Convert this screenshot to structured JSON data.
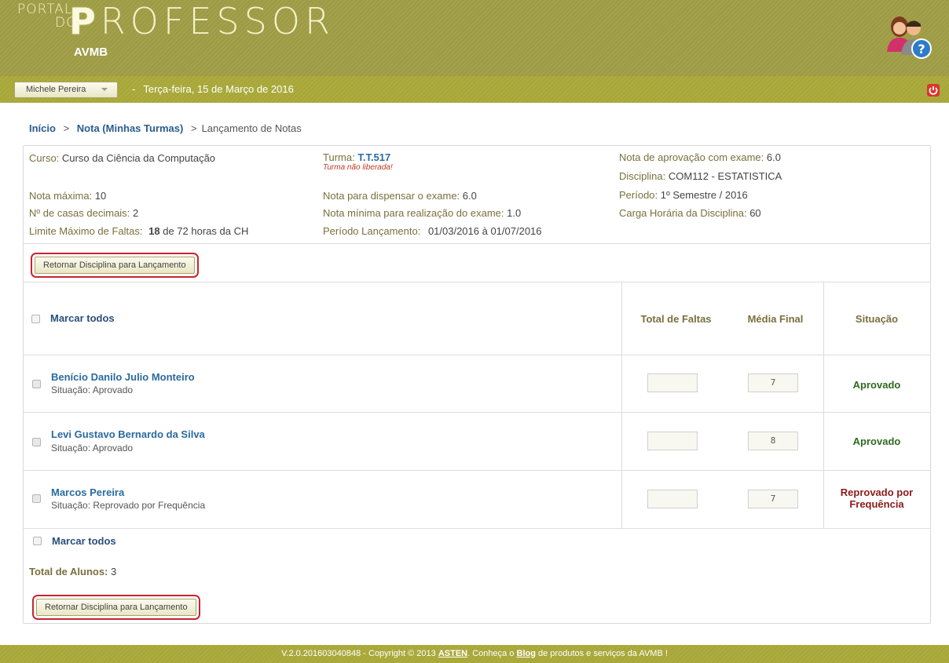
{
  "header": {
    "logo_small_1": "PORTAL",
    "logo_small_2": "DO",
    "logo_big_first": "P",
    "logo_big_rest": "ROFESSOR",
    "subtitle": "AVMB"
  },
  "nav": {
    "user": "Michele Pereira",
    "date": "Terça-feira, 15 de Março de 2016"
  },
  "breadcrumb": {
    "home": "Início",
    "section": "Nota (Minhas Turmas)",
    "current": "Lançamento de Notas",
    "sep": ">"
  },
  "info": {
    "curso_label": "Curso:",
    "curso": "Curso da Ciência da Computação",
    "turma_label": "Turma:",
    "turma": "T.T.517",
    "turma_warning": "Turma não liberada!",
    "nota_aprov_exame_label": "Nota de aprovação com exame:",
    "nota_aprov_exame": "6.0",
    "disciplina_label": "Disciplina:",
    "disciplina": "COM112 - ESTATISTICA",
    "nota_max_label": "Nota máxima:",
    "nota_max": "10",
    "nota_dispensa_label": "Nota para dispensar o exame:",
    "nota_dispensa": "6.0",
    "periodo_label": "Período:",
    "periodo": "1º Semestre / 2016",
    "casas_label": "Nº de casas decimais:",
    "casas": "2",
    "nota_min_exame_label": "Nota mínima para realização do exame:",
    "nota_min_exame": "1.0",
    "carga_label": "Carga Horária da Disciplina:",
    "carga": "60",
    "limite_label": "Limite Máximo de Faltas:",
    "limite": "18",
    "limite_suffix": "de 72 horas da CH",
    "lancamento_label": "Período Lançamento:",
    "lancamento": "01/03/2016 à 01/07/2016"
  },
  "button_return": "Retornar Disciplina para Lançamento",
  "table": {
    "mark_all": "Marcar todos",
    "col_faltas": "Total de Faltas",
    "col_media": "Média Final",
    "col_situacao": "Situação",
    "rows": [
      {
        "name": "Benício Danilo Julio Monteiro",
        "situacao_line": "Situação: Aprovado",
        "faltas": "",
        "media": "7",
        "status": "Aprovado"
      },
      {
        "name": "Levi Gustavo Bernardo da Silva",
        "situacao_line": "Situação: Aprovado",
        "faltas": "",
        "media": "8",
        "status": "Aprovado"
      },
      {
        "name": "Marcos Pereira",
        "situacao_line": "Situação: Reprovado por Frequência",
        "faltas": "",
        "media": "7",
        "status_l1": "Reprovado por",
        "status_l2": "Frequência"
      }
    ]
  },
  "total_label": "Total de Alunos:",
  "total": "3",
  "footer": {
    "pre": "V.2.0.201603040848 - Copyright © 2013",
    "asten": "ASTEN",
    "mid": ". Conheça o",
    "blog": "Blog",
    "post": "de produtos e serviços da AVMB !"
  },
  "colors": {
    "header_olive": "#a3a14b",
    "nav_olive": "#adac40",
    "link_blue": "#2a6aa0",
    "approved_green": "#2e6b1f",
    "failed_red": "#8b1a1a",
    "highlight_red": "#c8242f"
  },
  "icons": [
    "users-help-icon",
    "power-icon",
    "chevron-down-icon"
  ]
}
